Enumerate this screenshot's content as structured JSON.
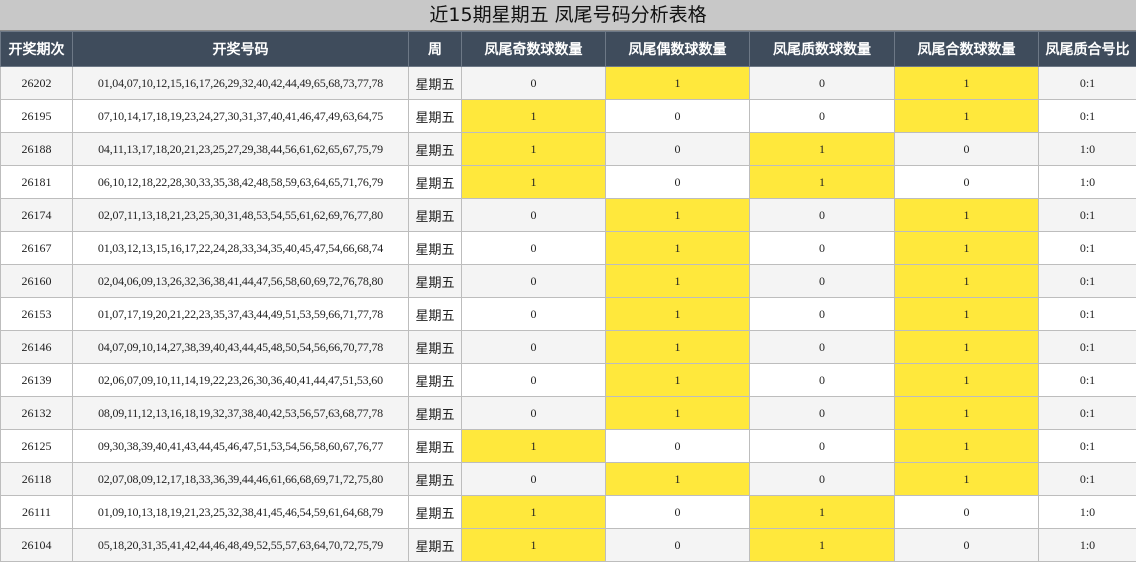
{
  "title": "近15期星期五 凤尾号码分析表格",
  "headers": [
    "开奖期次",
    "开奖号码",
    "周",
    "凤尾奇数球数量",
    "凤尾偶数球数量",
    "凤尾质数球数量",
    "凤尾合数球数量",
    "凤尾质合号比"
  ],
  "highlight_color": "#ffe83c",
  "header_color": "#3f4c5c",
  "rows": [
    {
      "issue": "26202",
      "numbers": "01,04,07,10,12,15,16,17,26,29,32,40,42,44,49,65,68,73,77,78",
      "week": "星期五",
      "odd": "0",
      "even": "1",
      "prime": "0",
      "composite": "1",
      "ratio": "0:1"
    },
    {
      "issue": "26195",
      "numbers": "07,10,14,17,18,19,23,24,27,30,31,37,40,41,46,47,49,63,64,75",
      "week": "星期五",
      "odd": "1",
      "even": "0",
      "prime": "0",
      "composite": "1",
      "ratio": "0:1"
    },
    {
      "issue": "26188",
      "numbers": "04,11,13,17,18,20,21,23,25,27,29,38,44,56,61,62,65,67,75,79",
      "week": "星期五",
      "odd": "1",
      "even": "0",
      "prime": "1",
      "composite": "0",
      "ratio": "1:0"
    },
    {
      "issue": "26181",
      "numbers": "06,10,12,18,22,28,30,33,35,38,42,48,58,59,63,64,65,71,76,79",
      "week": "星期五",
      "odd": "1",
      "even": "0",
      "prime": "1",
      "composite": "0",
      "ratio": "1:0"
    },
    {
      "issue": "26174",
      "numbers": "02,07,11,13,18,21,23,25,30,31,48,53,54,55,61,62,69,76,77,80",
      "week": "星期五",
      "odd": "0",
      "even": "1",
      "prime": "0",
      "composite": "1",
      "ratio": "0:1"
    },
    {
      "issue": "26167",
      "numbers": "01,03,12,13,15,16,17,22,24,28,33,34,35,40,45,47,54,66,68,74",
      "week": "星期五",
      "odd": "0",
      "even": "1",
      "prime": "0",
      "composite": "1",
      "ratio": "0:1"
    },
    {
      "issue": "26160",
      "numbers": "02,04,06,09,13,26,32,36,38,41,44,47,56,58,60,69,72,76,78,80",
      "week": "星期五",
      "odd": "0",
      "even": "1",
      "prime": "0",
      "composite": "1",
      "ratio": "0:1"
    },
    {
      "issue": "26153",
      "numbers": "01,07,17,19,20,21,22,23,35,37,43,44,49,51,53,59,66,71,77,78",
      "week": "星期五",
      "odd": "0",
      "even": "1",
      "prime": "0",
      "composite": "1",
      "ratio": "0:1"
    },
    {
      "issue": "26146",
      "numbers": "04,07,09,10,14,27,38,39,40,43,44,45,48,50,54,56,66,70,77,78",
      "week": "星期五",
      "odd": "0",
      "even": "1",
      "prime": "0",
      "composite": "1",
      "ratio": "0:1"
    },
    {
      "issue": "26139",
      "numbers": "02,06,07,09,10,11,14,19,22,23,26,30,36,40,41,44,47,51,53,60",
      "week": "星期五",
      "odd": "0",
      "even": "1",
      "prime": "0",
      "composite": "1",
      "ratio": "0:1"
    },
    {
      "issue": "26132",
      "numbers": "08,09,11,12,13,16,18,19,32,37,38,40,42,53,56,57,63,68,77,78",
      "week": "星期五",
      "odd": "0",
      "even": "1",
      "prime": "0",
      "composite": "1",
      "ratio": "0:1"
    },
    {
      "issue": "26125",
      "numbers": "09,30,38,39,40,41,43,44,45,46,47,51,53,54,56,58,60,67,76,77",
      "week": "星期五",
      "odd": "1",
      "even": "0",
      "prime": "0",
      "composite": "1",
      "ratio": "0:1"
    },
    {
      "issue": "26118",
      "numbers": "02,07,08,09,12,17,18,33,36,39,44,46,61,66,68,69,71,72,75,80",
      "week": "星期五",
      "odd": "0",
      "even": "1",
      "prime": "0",
      "composite": "1",
      "ratio": "0:1"
    },
    {
      "issue": "26111",
      "numbers": "01,09,10,13,18,19,21,23,25,32,38,41,45,46,54,59,61,64,68,79",
      "week": "星期五",
      "odd": "1",
      "even": "0",
      "prime": "1",
      "composite": "0",
      "ratio": "1:0"
    },
    {
      "issue": "26104",
      "numbers": "05,18,20,31,35,41,42,44,46,48,49,52,55,57,63,64,70,72,75,79",
      "week": "星期五",
      "odd": "1",
      "even": "0",
      "prime": "1",
      "composite": "0",
      "ratio": "1:0"
    }
  ]
}
